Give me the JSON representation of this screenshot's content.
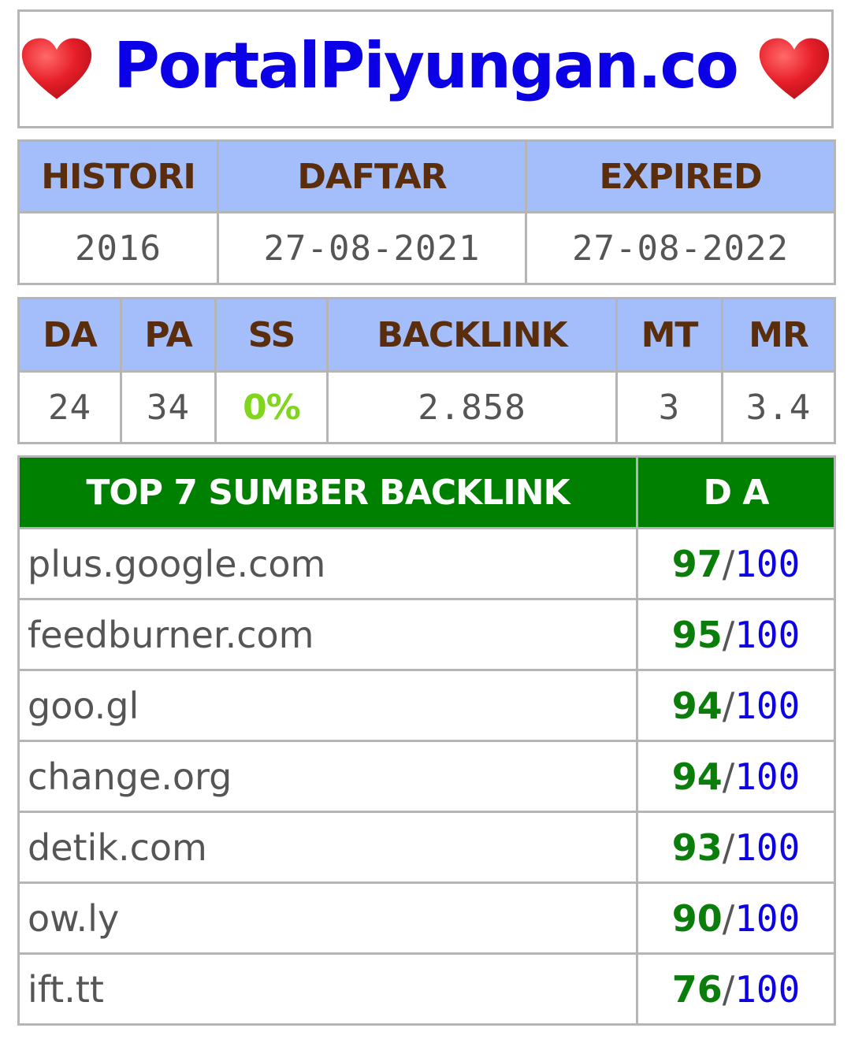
{
  "site": {
    "title": "PortalPiyungan.co",
    "accent_color": "#0b00e6",
    "heart_icon": "heart-icon"
  },
  "info_table": {
    "headers": [
      "HISTORI",
      "DAFTAR",
      "EXPIRED"
    ],
    "values": [
      "2016",
      "27-08-2021",
      "27-08-2022"
    ]
  },
  "metrics_table": {
    "headers": [
      "DA",
      "PA",
      "SS",
      "BACKLINK",
      "MT",
      "MR"
    ],
    "values": [
      "24",
      "34",
      "0%",
      "2.858",
      "3",
      "3.4"
    ]
  },
  "backlinks_table": {
    "header_title": "TOP 7 SUMBER BACKLINK",
    "header_score": "D A",
    "header_color": "#008000",
    "separator": "/",
    "max": "100",
    "rows": [
      {
        "domain": "plus.google.com",
        "score": "97"
      },
      {
        "domain": "feedburner.com",
        "score": "95"
      },
      {
        "domain": "goo.gl",
        "score": "94"
      },
      {
        "domain": "change.org",
        "score": "94"
      },
      {
        "domain": "detik.com",
        "score": "93"
      },
      {
        "domain": "ow.ly",
        "score": "90"
      },
      {
        "domain": "ift.tt",
        "score": "76"
      }
    ]
  }
}
